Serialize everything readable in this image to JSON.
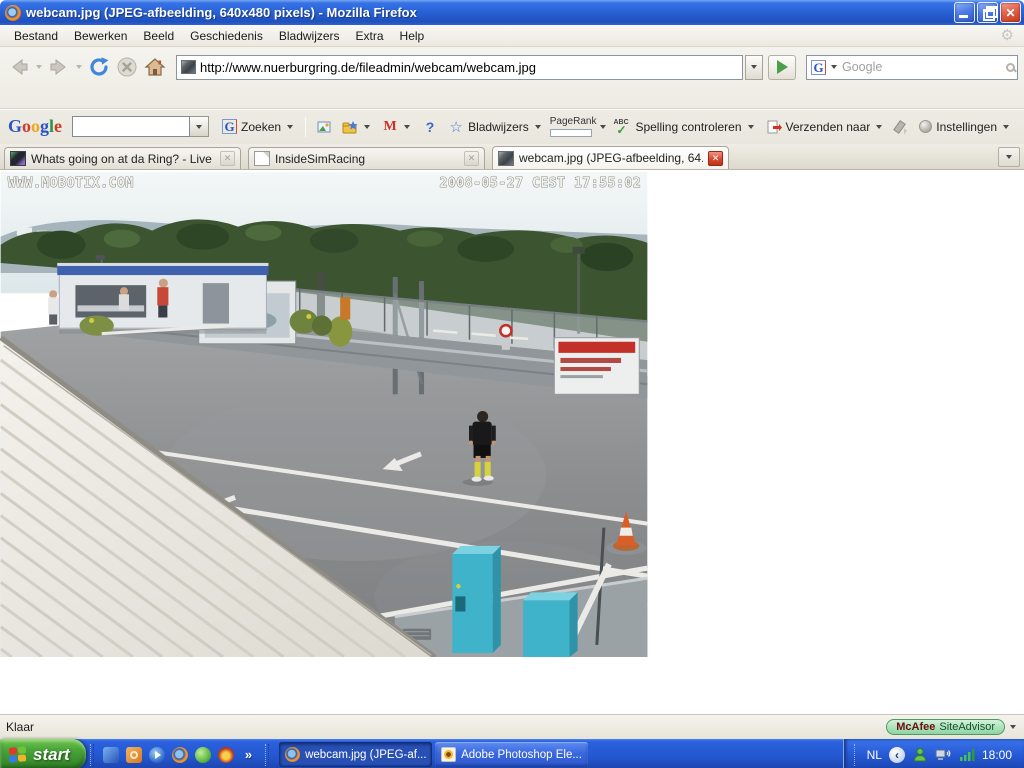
{
  "window": {
    "title": "webcam.jpg (JPEG-afbeelding, 640x480 pixels) - Mozilla Firefox"
  },
  "menu_bar": {
    "items": [
      "Bestand",
      "Bewerken",
      "Beeld",
      "Geschiedenis",
      "Bladwijzers",
      "Extra",
      "Help"
    ]
  },
  "nav_toolbar": {
    "url": "http://www.nuerburgring.de/fileadmin/webcam/webcam.jpg",
    "search_placeholder": "Google"
  },
  "google_toolbar": {
    "logo_letters": [
      "G",
      "o",
      "o",
      "g",
      "l",
      "e"
    ],
    "search_value": "",
    "g_letter": "G",
    "zoeken_label": "Zoeken",
    "bladwijzers_label": "Bladwijzers",
    "pagerank_label": "PageRank",
    "abc_label": "ABC",
    "spelling_label": "Spelling controleren",
    "verzenden_label": "Verzenden naar",
    "instellingen_label": "Instellingen"
  },
  "tab_bar": {
    "tabs": [
      {
        "label": "Whats going on at da Ring? - Live for ..."
      },
      {
        "label": "InsideSimRacing"
      },
      {
        "label": "webcam.jpg (JPEG-afbeelding, 64..."
      }
    ]
  },
  "webcam": {
    "watermark": "WWW.MOBOTIX.COM",
    "timestamp": "2008-05-27 CEST 17:55:02"
  },
  "status_bar": {
    "text": "Klaar",
    "mcafee_brand": "McAfee",
    "mcafee_product": "SiteAdvisor"
  },
  "taskbar": {
    "start_label": "start",
    "window_buttons": [
      {
        "label": "webcam.jpg (JPEG-af..."
      },
      {
        "label": "Adobe Photoshop Ele..."
      }
    ],
    "tray": {
      "language": "NL",
      "clock": "18:00"
    }
  },
  "icons": {
    "close_x": "✕",
    "gear": "⚙",
    "gmail_m": "M",
    "help_mark": "?",
    "star_outline": "☆",
    "check": "✓",
    "overflow_chevron": "»",
    "hide_chevron": "‹"
  }
}
